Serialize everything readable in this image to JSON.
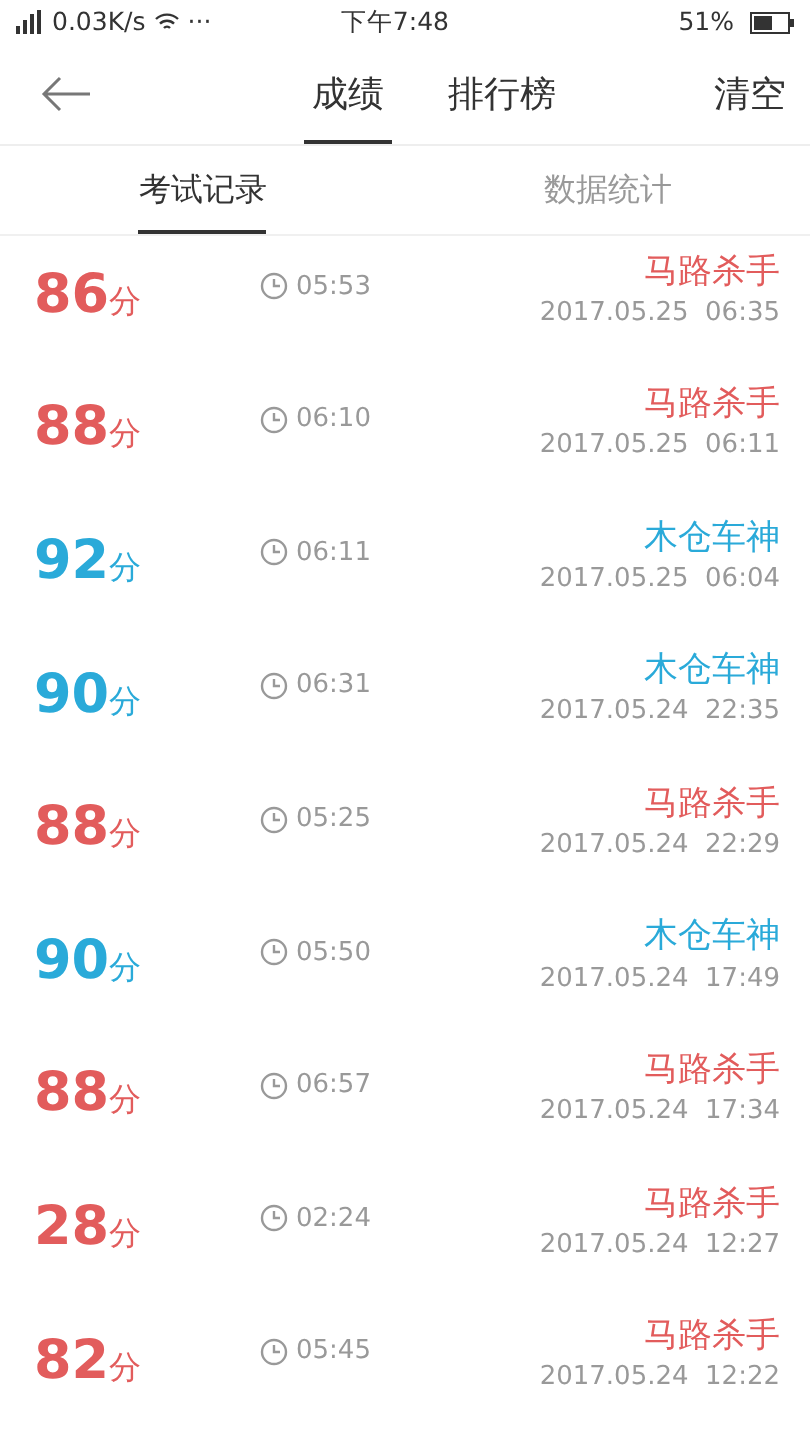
{
  "status_bar": {
    "speed": "0.03K/s",
    "more": "···",
    "time": "下午7:48",
    "battery": "51%"
  },
  "header": {
    "tabs": [
      {
        "label": "成绩",
        "selected": true
      },
      {
        "label": "排行榜",
        "selected": false
      }
    ],
    "action": "清空"
  },
  "sub_tabs": [
    {
      "label": "考试记录",
      "selected": true
    },
    {
      "label": "数据统计",
      "selected": false
    }
  ],
  "records": [
    {
      "score": "86",
      "unit": "分",
      "duration": "05:53",
      "title": "马路杀手",
      "date": "2017.05.25  06:35",
      "color": "#e25c5c"
    },
    {
      "score": "88",
      "unit": "分",
      "duration": "06:10",
      "title": "马路杀手",
      "date": "2017.05.25  06:11",
      "color": "#e25c5c"
    },
    {
      "score": "92",
      "unit": "分",
      "duration": "06:11",
      "title": "木仓车神",
      "date": "2017.05.25  06:04",
      "color": "#2aaad9"
    },
    {
      "score": "90",
      "unit": "分",
      "duration": "06:31",
      "title": "木仓车神",
      "date": "2017.05.24  22:35",
      "color": "#2aaad9"
    },
    {
      "score": "88",
      "unit": "分",
      "duration": "05:25",
      "title": "马路杀手",
      "date": "2017.05.24  22:29",
      "color": "#e25c5c"
    },
    {
      "score": "90",
      "unit": "分",
      "duration": "05:50",
      "title": "木仓车神",
      "date": "2017.05.24  17:49",
      "color": "#2aaad9"
    },
    {
      "score": "88",
      "unit": "分",
      "duration": "06:57",
      "title": "马路杀手",
      "date": "2017.05.24  17:34",
      "color": "#e25c5c"
    },
    {
      "score": "28",
      "unit": "分",
      "duration": "02:24",
      "title": "马路杀手",
      "date": "2017.05.24  12:27",
      "color": "#e25c5c"
    },
    {
      "score": "82",
      "unit": "分",
      "duration": "05:45",
      "title": "马路杀手",
      "date": "2017.05.24  12:22",
      "color": "#e25c5c"
    }
  ]
}
